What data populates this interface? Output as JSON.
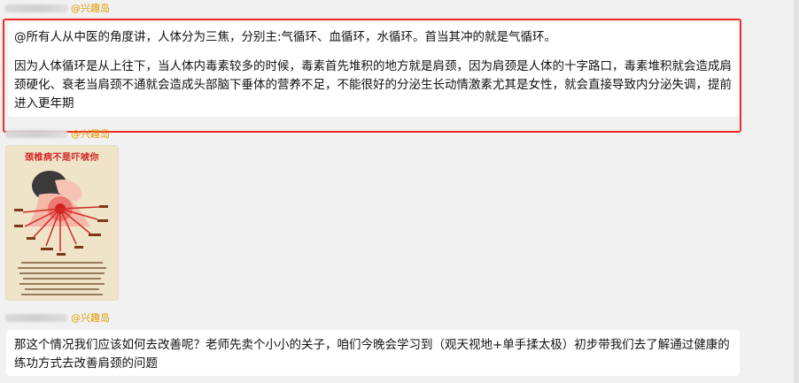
{
  "messages": [
    {
      "sender_tag": "@兴趣岛",
      "paragraphs": [
        "@所有人从中医的角度讲，人体分为三焦，分别主:气循环、血循环，水循环。首当其冲的就是气循环。",
        "因为人体循环是从上往下，当人体内毒素较多的时候，毒素首先堆积的地方就是肩颈，因为肩颈是人体的十字路口，毒素堆积就会造成肩颈硬化、衰老当肩颈不通就会造成头部脑下垂体的营养不足，不能很好的分泌生长动情激素尤其是女性，就会直接导致内分泌失调，提前进入更年期"
      ],
      "highlighted": true
    },
    {
      "sender_tag": "@兴趣岛",
      "image": {
        "title": "颈椎病不是吓唬你",
        "labels": [
          "头晕",
          "耳鸣",
          "恶心",
          "上肢麻木",
          "胸闷",
          "心慌",
          "落枕",
          "视物不清",
          "失眠",
          "颈椎",
          "脑梗"
        ]
      }
    },
    {
      "sender_tag": "@兴趣岛",
      "paragraphs": [
        "那这个情况我们应该如何去改善呢？老师先卖个小小的关子，咱们今晚会学习到（观天视地+单手揉太极）初步带我们去了解通过健康的练功方式去改善肩颈的问题"
      ]
    }
  ],
  "colors": {
    "highlight_border": "#ee2b2b",
    "sender_tag": "#e09b00",
    "background": "#f1f1f1",
    "bubble": "#ffffff",
    "poster_title": "#d32727"
  }
}
